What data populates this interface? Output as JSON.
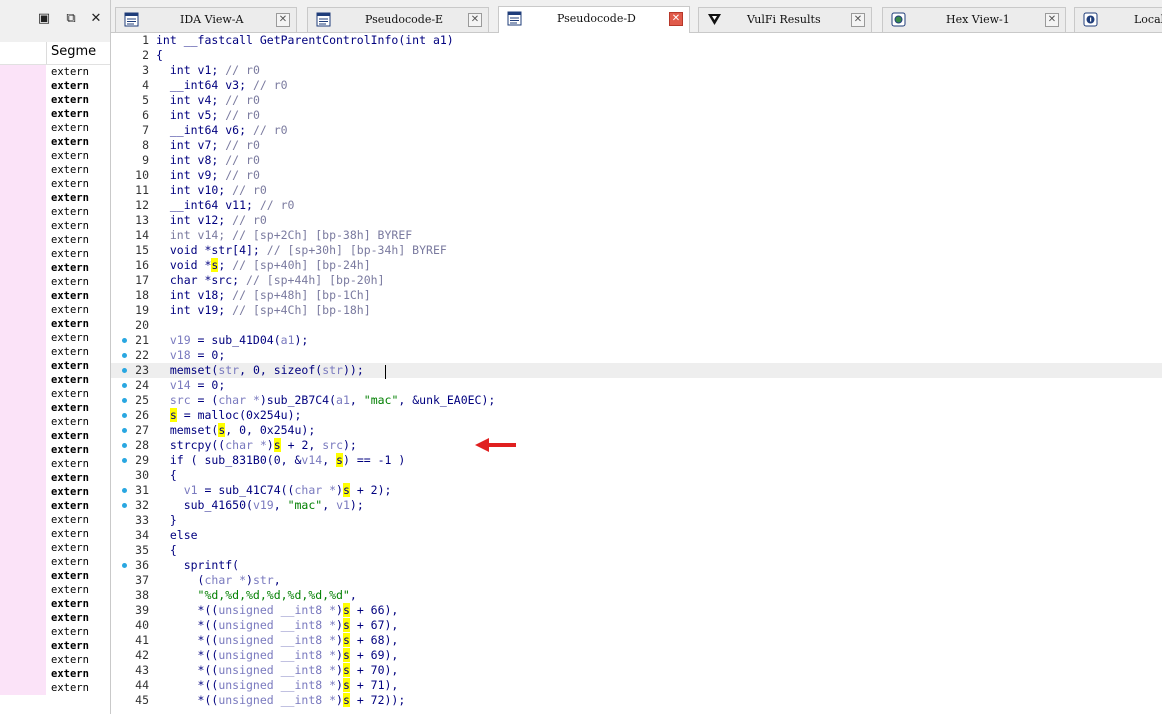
{
  "left_panel": {
    "header": "Segme",
    "rows": [
      {
        "text": "extern",
        "bold": false
      },
      {
        "text": "extern",
        "bold": true
      },
      {
        "text": "extern",
        "bold": true
      },
      {
        "text": "extern",
        "bold": true
      },
      {
        "text": "extern",
        "bold": false
      },
      {
        "text": "extern",
        "bold": true
      },
      {
        "text": "extern",
        "bold": false
      },
      {
        "text": "extern",
        "bold": false
      },
      {
        "text": "extern",
        "bold": false
      },
      {
        "text": "extern",
        "bold": true
      },
      {
        "text": "extern",
        "bold": false
      },
      {
        "text": "extern",
        "bold": false
      },
      {
        "text": "extern",
        "bold": false
      },
      {
        "text": "extern",
        "bold": false
      },
      {
        "text": "extern",
        "bold": true
      },
      {
        "text": "extern",
        "bold": false
      },
      {
        "text": "extern",
        "bold": true
      },
      {
        "text": "extern",
        "bold": false
      },
      {
        "text": "extern",
        "bold": true
      },
      {
        "text": "extern",
        "bold": false
      },
      {
        "text": "extern",
        "bold": false
      },
      {
        "text": "extern",
        "bold": true
      },
      {
        "text": "extern",
        "bold": true
      },
      {
        "text": "extern",
        "bold": false
      },
      {
        "text": "extern",
        "bold": true
      },
      {
        "text": "extern",
        "bold": false
      },
      {
        "text": "extern",
        "bold": true
      },
      {
        "text": "extern",
        "bold": true
      },
      {
        "text": "extern",
        "bold": false
      },
      {
        "text": "extern",
        "bold": true
      },
      {
        "text": "extern",
        "bold": true
      },
      {
        "text": "extern",
        "bold": true
      },
      {
        "text": "extern",
        "bold": false
      },
      {
        "text": "extern",
        "bold": false
      },
      {
        "text": "extern",
        "bold": false
      },
      {
        "text": "extern",
        "bold": false
      },
      {
        "text": "extern",
        "bold": true
      },
      {
        "text": "extern",
        "bold": false
      },
      {
        "text": "extern",
        "bold": true
      },
      {
        "text": "extern",
        "bold": true
      },
      {
        "text": "extern",
        "bold": false
      },
      {
        "text": "extern",
        "bold": true
      },
      {
        "text": "extern",
        "bold": false
      },
      {
        "text": "extern",
        "bold": true
      },
      {
        "text": "extern",
        "bold": false
      }
    ]
  },
  "tabs": [
    {
      "label": "IDA View-A",
      "icon": "disassembly-view-icon",
      "active": false
    },
    {
      "label": "Pseudocode-E",
      "icon": "pseudocode-icon",
      "active": false
    },
    {
      "label": "Pseudocode-D",
      "icon": "pseudocode-icon",
      "active": true
    },
    {
      "label": "VulFi Results",
      "icon": "vulfi-icon",
      "active": false
    },
    {
      "label": "Hex View-1",
      "icon": "hex-view-icon",
      "active": false
    },
    {
      "label": "Local",
      "icon": "info-icon",
      "active": false
    }
  ],
  "colors": {
    "keyword": "#00007f",
    "comment": "#7a7a9f",
    "variable": "#7a7abf",
    "string": "#007f00",
    "highlight": "#ffff00",
    "breakpoint_dot": "#29a7e1",
    "arrow": "#e02020",
    "left_row_bg": "#fbe3f8"
  },
  "code_lines": [
    {
      "n": "1",
      "dot": false,
      "t": [
        [
          "k",
          "int __fastcall GetParentControlInfo(int a1)"
        ]
      ]
    },
    {
      "n": "2",
      "dot": false,
      "t": [
        [
          "k",
          "{"
        ]
      ]
    },
    {
      "n": "3",
      "dot": false,
      "t": [
        [
          "k",
          "  int v1; "
        ],
        [
          "g",
          "// r0"
        ]
      ]
    },
    {
      "n": "4",
      "dot": false,
      "t": [
        [
          "k",
          "  __int64 v3; "
        ],
        [
          "g",
          "// r0"
        ]
      ]
    },
    {
      "n": "5",
      "dot": false,
      "t": [
        [
          "k",
          "  int v4; "
        ],
        [
          "g",
          "// r0"
        ]
      ]
    },
    {
      "n": "6",
      "dot": false,
      "t": [
        [
          "k",
          "  int v5; "
        ],
        [
          "g",
          "// r0"
        ]
      ]
    },
    {
      "n": "7",
      "dot": false,
      "t": [
        [
          "k",
          "  __int64 v6; "
        ],
        [
          "g",
          "// r0"
        ]
      ]
    },
    {
      "n": "8",
      "dot": false,
      "t": [
        [
          "k",
          "  int v7; "
        ],
        [
          "g",
          "// r0"
        ]
      ]
    },
    {
      "n": "9",
      "dot": false,
      "t": [
        [
          "k",
          "  int v8; "
        ],
        [
          "g",
          "// r0"
        ]
      ]
    },
    {
      "n": "10",
      "dot": false,
      "t": [
        [
          "k",
          "  int v9; "
        ],
        [
          "g",
          "// r0"
        ]
      ]
    },
    {
      "n": "11",
      "dot": false,
      "t": [
        [
          "k",
          "  int v10; "
        ],
        [
          "g",
          "// r0"
        ]
      ]
    },
    {
      "n": "12",
      "dot": false,
      "t": [
        [
          "k",
          "  __int64 v11; "
        ],
        [
          "g",
          "// r0"
        ]
      ]
    },
    {
      "n": "13",
      "dot": false,
      "t": [
        [
          "k",
          "  int v12; "
        ],
        [
          "g",
          "// r0"
        ]
      ]
    },
    {
      "n": "14",
      "dot": false,
      "t": [
        [
          "g",
          "  int v14; // [sp+2Ch] [bp-38h] BYREF"
        ]
      ]
    },
    {
      "n": "15",
      "dot": false,
      "t": [
        [
          "k",
          "  void *str[4]; "
        ],
        [
          "g",
          "// [sp+30h] [bp-34h] BYREF"
        ]
      ]
    },
    {
      "n": "16",
      "dot": false,
      "t": [
        [
          "k",
          "  void *"
        ],
        [
          "h",
          "s"
        ],
        [
          "k",
          "; "
        ],
        [
          "g",
          "// [sp+40h] [bp-24h]"
        ]
      ]
    },
    {
      "n": "17",
      "dot": false,
      "t": [
        [
          "k",
          "  char *src; "
        ],
        [
          "g",
          "// [sp+44h] [bp-20h]"
        ]
      ]
    },
    {
      "n": "18",
      "dot": false,
      "t": [
        [
          "k",
          "  int v18; "
        ],
        [
          "g",
          "// [sp+48h] [bp-1Ch]"
        ]
      ]
    },
    {
      "n": "19",
      "dot": false,
      "t": [
        [
          "k",
          "  int v19; "
        ],
        [
          "g",
          "// [sp+4Ch] [bp-18h]"
        ]
      ]
    },
    {
      "n": "20",
      "dot": false,
      "t": [
        [
          "k",
          ""
        ]
      ]
    },
    {
      "n": "21",
      "dot": true,
      "t": [
        [
          "c",
          "  v19"
        ],
        [
          "k",
          " = sub_41D04("
        ],
        [
          "c",
          "a1"
        ],
        [
          "k",
          ");"
        ]
      ]
    },
    {
      "n": "22",
      "dot": true,
      "t": [
        [
          "c",
          "  v18"
        ],
        [
          "k",
          " = 0;"
        ]
      ]
    },
    {
      "n": "23",
      "dot": true,
      "cur": true,
      "t": [
        [
          "k",
          "  memset("
        ],
        [
          "c",
          "str"
        ],
        [
          "k",
          ", 0, sizeof("
        ],
        [
          "c",
          "str"
        ],
        [
          "k",
          "));"
        ]
      ]
    },
    {
      "n": "24",
      "dot": true,
      "t": [
        [
          "c",
          "  v14"
        ],
        [
          "k",
          " = 0;"
        ]
      ]
    },
    {
      "n": "25",
      "dot": true,
      "t": [
        [
          "c",
          "  src"
        ],
        [
          "k",
          " = ("
        ],
        [
          "c",
          "char *"
        ],
        [
          "k",
          ")sub_2B7C4("
        ],
        [
          "c",
          "a1"
        ],
        [
          "k",
          ", "
        ],
        [
          "s",
          "\"mac\""
        ],
        [
          "k",
          ", &unk_EA0EC);"
        ]
      ]
    },
    {
      "n": "26",
      "dot": true,
      "t": [
        [
          "k",
          "  "
        ],
        [
          "h",
          "s"
        ],
        [
          "k",
          " = malloc(0x254u);"
        ]
      ]
    },
    {
      "n": "27",
      "dot": true,
      "t": [
        [
          "k",
          "  memset("
        ],
        [
          "h",
          "s"
        ],
        [
          "k",
          ", 0, 0x254u);"
        ]
      ]
    },
    {
      "n": "28",
      "dot": true,
      "t": [
        [
          "k",
          "  strcpy(("
        ],
        [
          "c",
          "char *"
        ],
        [
          "k",
          ")"
        ],
        [
          "h",
          "s"
        ],
        [
          "k",
          " + 2, "
        ],
        [
          "c",
          "src"
        ],
        [
          "k",
          ");"
        ]
      ]
    },
    {
      "n": "29",
      "dot": true,
      "t": [
        [
          "k",
          "  if ( sub_831B0(0, &"
        ],
        [
          "c",
          "v14"
        ],
        [
          "k",
          ", "
        ],
        [
          "h",
          "s"
        ],
        [
          "k",
          ") == -1 )"
        ]
      ]
    },
    {
      "n": "30",
      "dot": false,
      "t": [
        [
          "k",
          "  {"
        ]
      ]
    },
    {
      "n": "31",
      "dot": true,
      "t": [
        [
          "c",
          "    v1"
        ],
        [
          "k",
          " = sub_41C74(("
        ],
        [
          "c",
          "char *"
        ],
        [
          "k",
          ")"
        ],
        [
          "h",
          "s"
        ],
        [
          "k",
          " + 2);"
        ]
      ]
    },
    {
      "n": "32",
      "dot": true,
      "t": [
        [
          "k",
          "    sub_41650("
        ],
        [
          "c",
          "v19"
        ],
        [
          "k",
          ", "
        ],
        [
          "s",
          "\"mac\""
        ],
        [
          "k",
          ", "
        ],
        [
          "c",
          "v1"
        ],
        [
          "k",
          ");"
        ]
      ]
    },
    {
      "n": "33",
      "dot": false,
      "t": [
        [
          "k",
          "  }"
        ]
      ]
    },
    {
      "n": "34",
      "dot": false,
      "t": [
        [
          "k",
          "  else"
        ]
      ]
    },
    {
      "n": "35",
      "dot": false,
      "t": [
        [
          "k",
          "  {"
        ]
      ]
    },
    {
      "n": "36",
      "dot": true,
      "t": [
        [
          "k",
          "    sprintf("
        ]
      ]
    },
    {
      "n": "37",
      "dot": false,
      "t": [
        [
          "k",
          "      ("
        ],
        [
          "c",
          "char *"
        ],
        [
          "k",
          ")"
        ],
        [
          "c",
          "str"
        ],
        [
          "k",
          ","
        ]
      ]
    },
    {
      "n": "38",
      "dot": false,
      "t": [
        [
          "s",
          "      \"%d,%d,%d,%d,%d,%d,%d\""
        ],
        [
          "k",
          ","
        ]
      ]
    },
    {
      "n": "39",
      "dot": false,
      "t": [
        [
          "k",
          "      *(("
        ],
        [
          "c",
          "unsigned __int8 *"
        ],
        [
          "k",
          ")"
        ],
        [
          "h",
          "s"
        ],
        [
          "k",
          " + 66),"
        ]
      ]
    },
    {
      "n": "40",
      "dot": false,
      "t": [
        [
          "k",
          "      *(("
        ],
        [
          "c",
          "unsigned __int8 *"
        ],
        [
          "k",
          ")"
        ],
        [
          "h",
          "s"
        ],
        [
          "k",
          " + 67),"
        ]
      ]
    },
    {
      "n": "41",
      "dot": false,
      "t": [
        [
          "k",
          "      *(("
        ],
        [
          "c",
          "unsigned __int8 *"
        ],
        [
          "k",
          ")"
        ],
        [
          "h",
          "s"
        ],
        [
          "k",
          " + 68),"
        ]
      ]
    },
    {
      "n": "42",
      "dot": false,
      "t": [
        [
          "k",
          "      *(("
        ],
        [
          "c",
          "unsigned __int8 *"
        ],
        [
          "k",
          ")"
        ],
        [
          "h",
          "s"
        ],
        [
          "k",
          " + 69),"
        ]
      ]
    },
    {
      "n": "43",
      "dot": false,
      "t": [
        [
          "k",
          "      *(("
        ],
        [
          "c",
          "unsigned __int8 *"
        ],
        [
          "k",
          ")"
        ],
        [
          "h",
          "s"
        ],
        [
          "k",
          " + 70),"
        ]
      ]
    },
    {
      "n": "44",
      "dot": false,
      "t": [
        [
          "k",
          "      *(("
        ],
        [
          "c",
          "unsigned __int8 *"
        ],
        [
          "k",
          ")"
        ],
        [
          "h",
          "s"
        ],
        [
          "k",
          " + 71),"
        ]
      ]
    },
    {
      "n": "45",
      "dot": false,
      "t": [
        [
          "k",
          "      *(("
        ],
        [
          "c",
          "unsigned __int8 *"
        ],
        [
          "k",
          ")"
        ],
        [
          "h",
          "s"
        ],
        [
          "k",
          " + 72));"
        ]
      ]
    }
  ]
}
